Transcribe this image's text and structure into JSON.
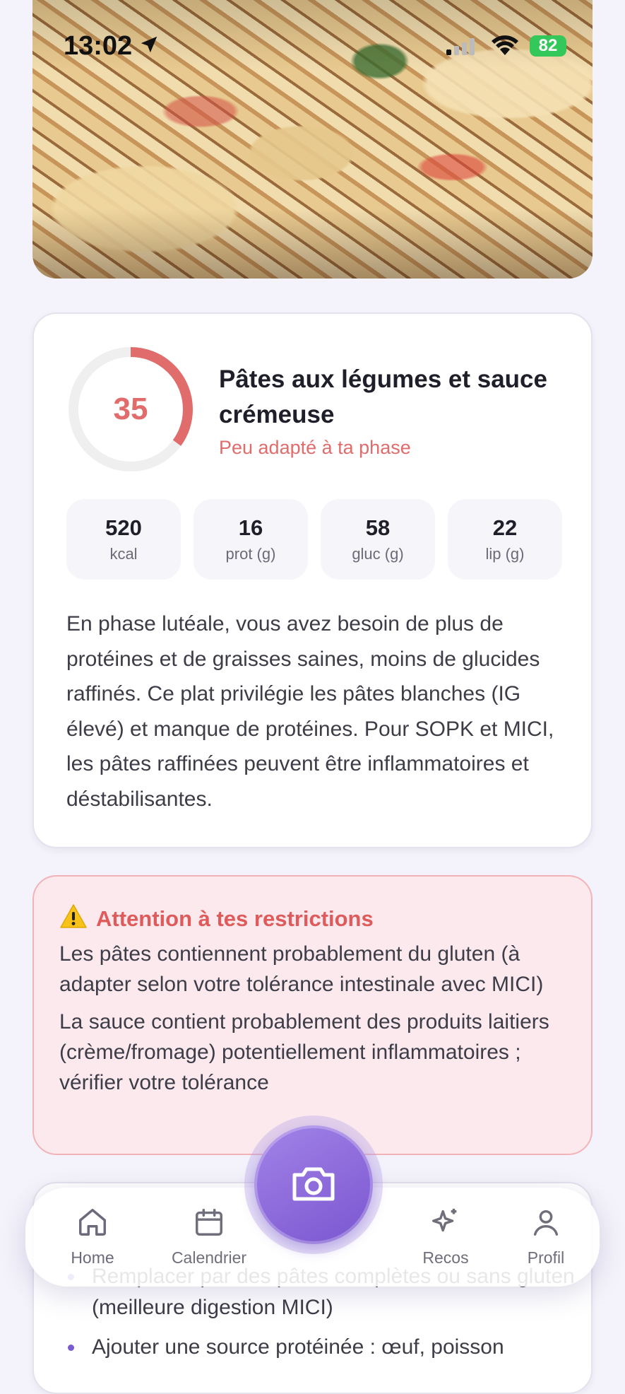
{
  "status_bar": {
    "time": "13:02",
    "battery": "82"
  },
  "score": {
    "value": "35",
    "fraction": 0.35,
    "color": "#e06c6c"
  },
  "dish": {
    "title": "Pâtes aux légumes et sauce crémeuse",
    "verdict": "Peu adapté à ta phase"
  },
  "macros": [
    {
      "value": "520",
      "unit": "kcal"
    },
    {
      "value": "16",
      "unit": "prot (g)"
    },
    {
      "value": "58",
      "unit": "gluc (g)"
    },
    {
      "value": "22",
      "unit": "lip (g)"
    }
  ],
  "explanation": "En phase lutéale, vous avez besoin de plus de protéines et de graisses saines, moins de glucides raffinés. Ce plat privilégie les pâtes blanches (IG élevé) et manque de protéines. Pour SOPK et MICI, les pâtes raffinées peuvent être inflammatoires et déstabilisantes.",
  "warning": {
    "icon": "warning-icon",
    "title": "Attention à tes restrictions",
    "items": [
      "Les pâtes contiennent probablement du gluten (à adapter selon votre tolérance intestinale avec MICI)",
      "La sauce contient probablement des produits laitiers (crème/fromage) potentiellement inflammatoires ; vérifier votre tolérance"
    ]
  },
  "tips": {
    "items": [
      "Remplacer par des pâtes complètes ou sans gluten (meilleure digestion MICI)",
      "Ajouter une source protéinée : œuf, poisson"
    ]
  },
  "nav": {
    "home": "Home",
    "calendar": "Calendrier",
    "recos": "Recos",
    "profile": "Profil"
  },
  "colors": {
    "accent": "#7a56cf",
    "danger": "#e06c6c"
  }
}
